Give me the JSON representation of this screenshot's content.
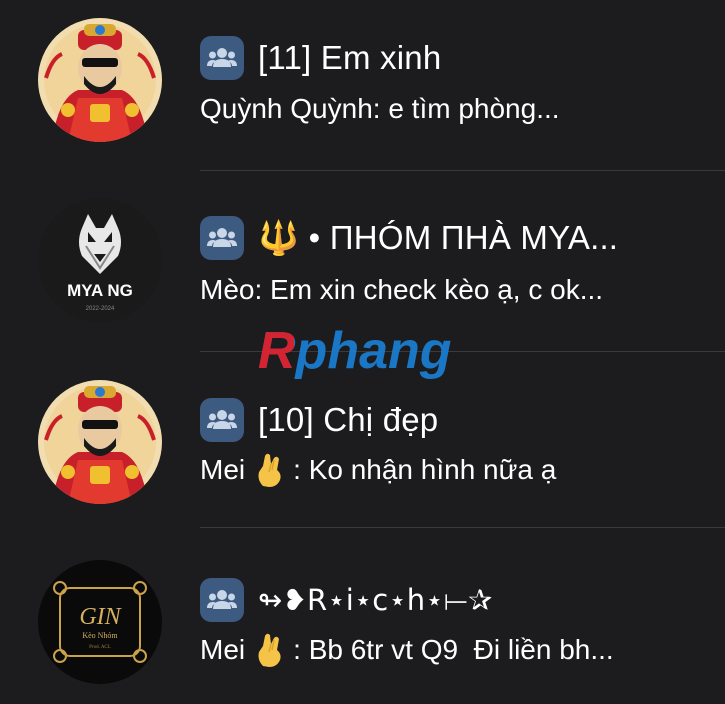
{
  "chats": [
    {
      "title": "[11] Em xinh",
      "sender": "Quỳnh Quỳnh",
      "message": "e tìm phòng...",
      "preview": "Quỳnh Quỳnh: e tìm phòng...",
      "avatar": "red-god-character",
      "is_group": true
    },
    {
      "title": "🔱 • ΠΗÓΜ ΠΗÀ ΜΥΑ...",
      "sender": "Mèo",
      "message": "Em xin check kèo ạ, c ok...",
      "preview": "Mèo: Em xin check kèo ạ, c ok...",
      "avatar": "wolf-logo",
      "avatar_text": "MYA NG",
      "avatar_subtext": "2022-2024",
      "is_group": true
    },
    {
      "title": "[10] Chị đẹp",
      "sender": "Mei",
      "message": "Ko nhận hình nữa ạ",
      "avatar": "red-god-character",
      "is_group": true
    },
    {
      "title": "↬❥R⋆i⋆c⋆h⋆⟝✰",
      "sender": "Mei",
      "message": "Bb 6tr vt Q9  Đi liền bh...",
      "avatar": "gin-logo",
      "avatar_text": "GIN",
      "avatar_subtext": "Kèo Nhóm",
      "avatar_small": "Prod. ACL",
      "is_group": true
    }
  ],
  "watermark": "Rphang",
  "colors": {
    "background": "#1c1c1e",
    "divider": "#3a3a3c",
    "group_badge": "#3d5a80",
    "text": "#ffffff",
    "watermark_red": "#e0202a",
    "watermark_blue": "#1a7fd4"
  }
}
